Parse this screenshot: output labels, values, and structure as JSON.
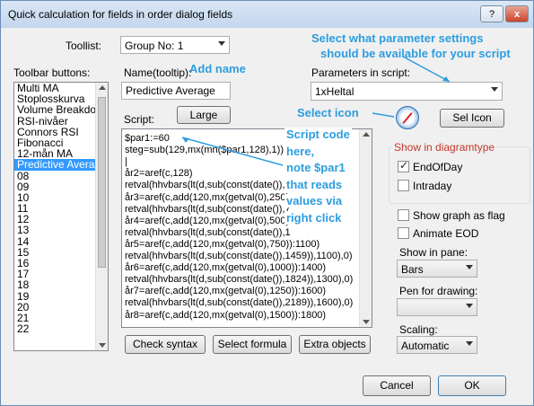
{
  "window": {
    "title": "Quick calculation for fields in order dialog fields",
    "help_label": "?",
    "close_label": "x"
  },
  "toollist": {
    "label": "Toollist:",
    "selected": "Group No: 1"
  },
  "toolbar": {
    "label": "Toolbar buttons:",
    "items": [
      "Multi MA",
      "Stoplosskurva",
      "Volume Breakdow",
      "RSI-nivåer",
      "Connors RSI",
      "Fibonacci",
      "12-mån MA",
      "Predictive Averag",
      "08",
      "09",
      "10",
      "11",
      "12",
      "13",
      "14",
      "15",
      "16",
      "17",
      "18",
      "19",
      "20",
      "21",
      "22"
    ],
    "selected_index": 7
  },
  "name": {
    "label": "Name(tooltip):",
    "value": "Predictive Average"
  },
  "script": {
    "label": "Script:",
    "large_button": "Large",
    "lines": [
      "$par1:=60",
      "steg=sub(129,mx(mn($par1,128),1))",
      "|",
      "år2=aref(c,128)",
      "retval(hhvbars(lt(d,sub(const(date()),3",
      "år3=aref(c,add(120,mx(getval(0),250)",
      "retval(hhvbars(lt(d,sub(const(date()),7",
      "år4=aref(c,add(120,mx(getval(0),500)",
      "retval(hhvbars(lt(d,sub(const(date()),1",
      "år5=aref(c,add(120,mx(getval(0),750)):1100)",
      "retval(hhvbars(lt(d,sub(const(date()),1459)),1100),0)",
      "år6=aref(c,add(120,mx(getval(0),1000)):1400)",
      "retval(hhvbars(lt(d,sub(const(date()),1824)),1300),0)",
      "år7=aref(c,add(120,mx(getval(0),1250)):1600)",
      "retval(hhvbars(lt(d,sub(const(date()),2189)),1600),0)",
      "år8=aref(c,add(120,mx(getval(0),1500)):1800)"
    ]
  },
  "buttons": {
    "check_syntax": "Check syntax",
    "select_formula": "Select formula",
    "extra_objects": "Extra objects",
    "sel_icon": "Sel Icon",
    "cancel": "Cancel",
    "ok": "OK"
  },
  "parameters": {
    "label": "Parameters in script:",
    "selected": "1xHeltal"
  },
  "show_in_diagram": {
    "legend": "Show in diagramtype",
    "end_of_day": {
      "label": "EndOfDay",
      "checked": true
    },
    "intraday": {
      "label": "Intraday",
      "checked": false
    }
  },
  "show_graph_as_flag": {
    "label": "Show graph as flag",
    "checked": false
  },
  "animate_eod": {
    "label": "Animate EOD",
    "checked": false
  },
  "show_in_pane": {
    "label": "Show in pane:",
    "selected": "Bars"
  },
  "pen_for_drawing": {
    "label": "Pen for drawing:",
    "selected": ""
  },
  "scaling": {
    "label": "Scaling:",
    "selected": "Automatic"
  },
  "annotations": {
    "add_name": "Add name",
    "select_params_1": "Select what parameter settings",
    "select_params_2": "should be available for your script",
    "select_icon": "Select icon",
    "script_code": [
      "Script code",
      "here,",
      "note $par1",
      "that reads",
      "values via",
      "right click"
    ]
  },
  "colors": {
    "annotation": "#2d9ddf",
    "selection": "#3399ff"
  }
}
